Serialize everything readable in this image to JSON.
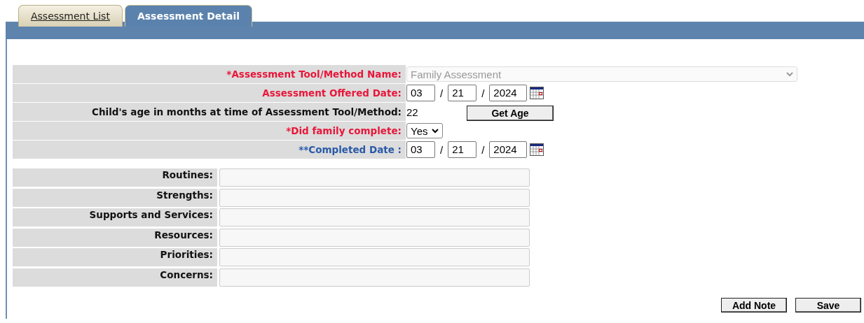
{
  "tabs": [
    {
      "label": "Assessment List",
      "selected": false
    },
    {
      "label": "Assessment Detail",
      "selected": true
    }
  ],
  "form": [
    {
      "kind": "select",
      "label": "*Assessment Tool/Method Name:",
      "color": "#e8173a",
      "value": "Family Assessment",
      "disabled": true
    },
    {
      "kind": "date",
      "label": "Assessment Offered Date:",
      "color": "#e8173a",
      "month": "03",
      "day": "21",
      "year": "2024"
    },
    {
      "kind": "age",
      "label": "Child's age in months at time of Assessment Tool/Method:",
      "color": "#111111",
      "value": "22",
      "button": "Get Age"
    },
    {
      "kind": "select",
      "label": "*Did family complete:",
      "color": "#e8173a",
      "value": "Yes",
      "disabled": false
    },
    {
      "kind": "date",
      "label": "**Completed Date :",
      "color": "#2a5aa8",
      "month": "03",
      "day": "21",
      "year": "2024"
    }
  ],
  "date_separator": "/",
  "notes": [
    {
      "label": "Routines:"
    },
    {
      "label": "Strengths:"
    },
    {
      "label": "Supports and Services:"
    },
    {
      "label": "Resources:"
    },
    {
      "label": "Priorities:"
    },
    {
      "label": "Concerns:"
    }
  ],
  "buttons": [
    "Add Note",
    "Save"
  ]
}
